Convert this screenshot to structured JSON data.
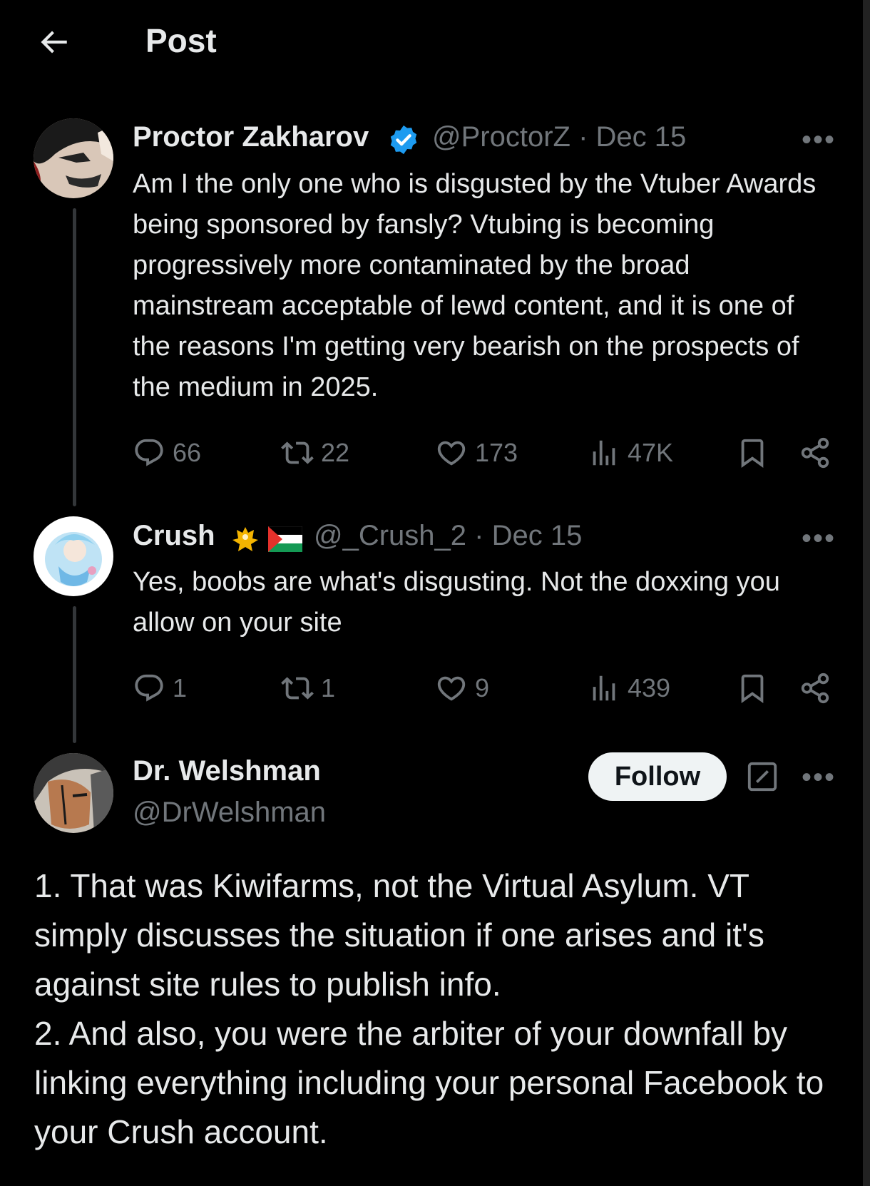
{
  "header": {
    "title": "Post"
  },
  "tweets": [
    {
      "name": "Proctor Zakharov",
      "handle": "@ProctorZ",
      "date": "Dec 15",
      "text": "Am I the only one who is disgusted by the Vtuber Awards being sponsored by fansly? Vtubing is becoming progressively more contaminated by the broad mainstream acceptable of lewd content, and it is one of the reasons I'm getting very bearish on the prospects of the medium in 2025.",
      "stats": {
        "replies": "66",
        "reposts": "22",
        "likes": "173",
        "views": "47K"
      }
    },
    {
      "name": "Crush",
      "handle": "@_Crush_2",
      "date": "Dec 15",
      "text": "Yes, boobs are what's disgusting. Not the doxxing you allow on your site",
      "stats": {
        "replies": "1",
        "reposts": "1",
        "likes": "9",
        "views": "439"
      }
    }
  ],
  "main_post": {
    "name": "Dr. Welshman",
    "handle": "@DrWelshman",
    "follow_label": "Follow",
    "paragraphs": [
      "1. That was Kiwifarms, not the Virtual Asylum. VT simply discusses the situation if one arises and it's against site rules to publish info.",
      "2. And also, you were the arbiter of your downfall by linking everything including your personal Facebook to your Crush account."
    ]
  },
  "separator": "·",
  "more_label": "•••",
  "colors": {
    "background": "#000000",
    "text": "#e7e9ea",
    "muted": "#71767b",
    "verified": "#1d9bf0",
    "follow_bg": "#eff3f4"
  },
  "icons": [
    "back-arrow-icon",
    "verified-badge-icon",
    "reply-icon",
    "repost-icon",
    "like-icon",
    "views-icon",
    "bookmark-icon",
    "share-icon",
    "edit-icon",
    "more-icon"
  ]
}
